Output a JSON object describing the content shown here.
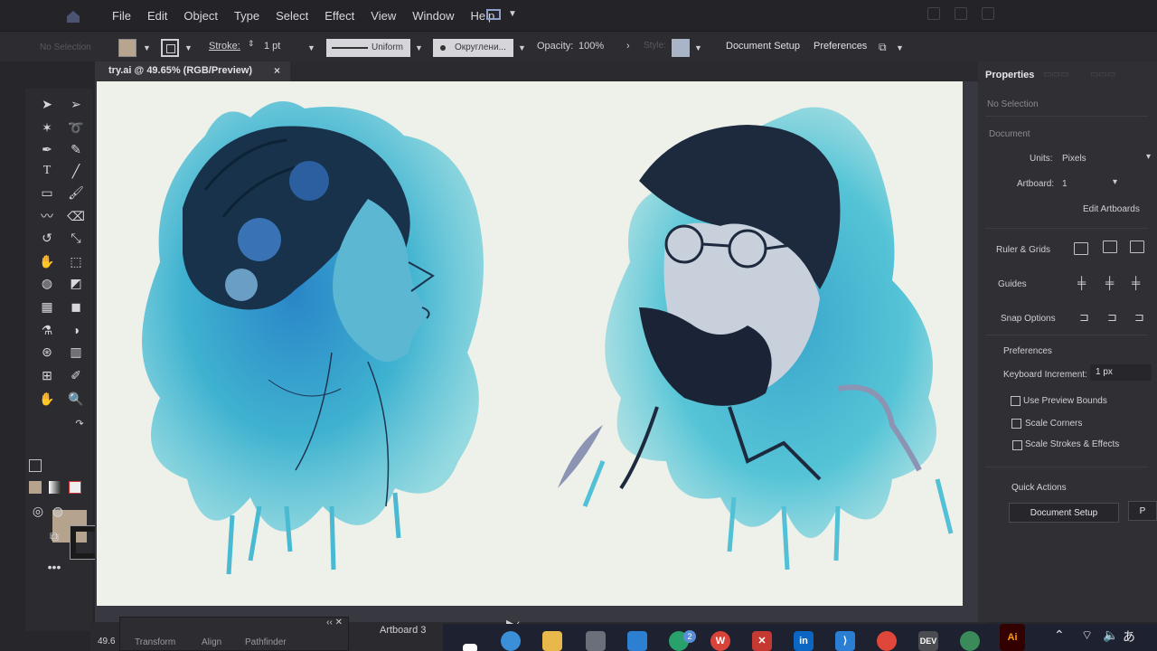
{
  "menubar": {
    "items": [
      "File",
      "Edit",
      "Object",
      "Type",
      "Select",
      "Effect",
      "View",
      "Window",
      "Help"
    ]
  },
  "control_bar": {
    "selection": "No Selection",
    "stroke_label": "Stroke:",
    "stroke_value": "1 pt",
    "variable_width": "Uniform",
    "brush": "Округлени...",
    "opacity_label": "Opacity:",
    "opacity_value": "100%",
    "style_label": "Style:",
    "document_setup": "Document Setup",
    "preferences": "Preferences"
  },
  "document_tab": {
    "title": "try.ai @ 49.65% (RGB/Preview)",
    "close": "×"
  },
  "properties": {
    "title": "Properties",
    "no_selection": "No Selection",
    "document": "Document",
    "units_label": "Units:",
    "units_value": "Pixels",
    "artboard_label": "Artboard:",
    "artboard_value": "1",
    "edit_artboards": "Edit Artboards",
    "ruler_grids": "Ruler & Grids",
    "guides": "Guides",
    "snap_options": "Snap Options",
    "preferences": "Preferences",
    "keyboard_increment_label": "Keyboard Increment:",
    "keyboard_increment_value": "1 px",
    "use_preview_bounds": "Use Preview Bounds",
    "scale_corners": "Scale Corners",
    "scale_strokes_effects": "Scale Strokes & Effects",
    "quick_actions": "Quick Actions",
    "document_setup_btn": "Document Setup"
  },
  "status": {
    "zoom": "49.6",
    "artboard_name": "Artboard 3"
  },
  "bottom_panel": {
    "tabs": [
      "Transform",
      "Align",
      "Pathfinder"
    ]
  },
  "taskbar": {
    "notification_badge": "2",
    "apps": [
      "vscode-icon",
      "chrome-icon",
      "devcpp-icon",
      "illustrator-icon"
    ],
    "illustrator_label": "Ai",
    "word_label": "W",
    "linkedin_label": "in",
    "dev_label": "DEV"
  },
  "colors": {
    "fill": "#b6a38d",
    "stroke": "#1a1a1a",
    "accent_blue": "#3fb2d0"
  }
}
